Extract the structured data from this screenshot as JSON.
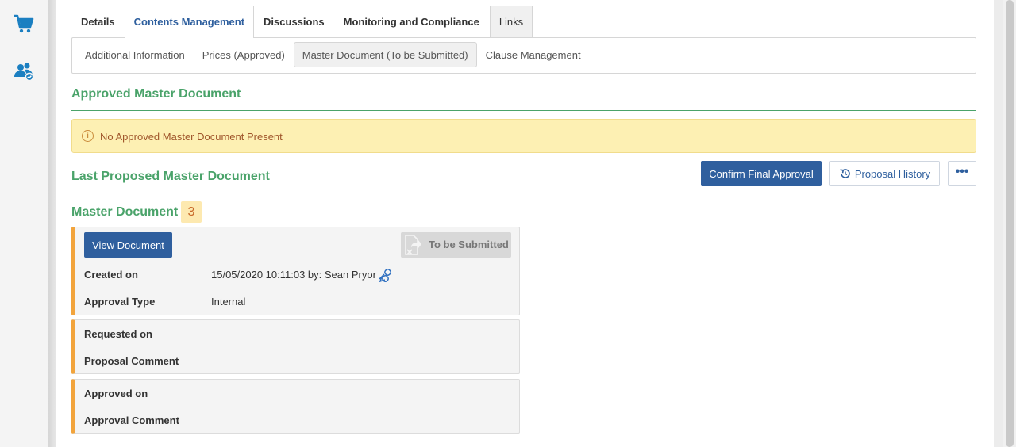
{
  "sidebar": {
    "icons": [
      {
        "name": "cart-icon"
      },
      {
        "name": "users-check-icon"
      }
    ]
  },
  "tabs": [
    {
      "label": "Details"
    },
    {
      "label": "Contents Management",
      "active": true
    },
    {
      "label": "Discussions"
    },
    {
      "label": "Monitoring and Compliance"
    },
    {
      "label": "Links"
    }
  ],
  "subtabs": [
    {
      "label": "Additional Information"
    },
    {
      "label": "Prices (Approved)"
    },
    {
      "label": "Master Document (To be Submitted)",
      "active": true
    },
    {
      "label": "Clause Management"
    }
  ],
  "approved_section": {
    "title": "Approved Master Document",
    "alert_text": "No Approved Master Document Present",
    "alert_icon": "info-icon"
  },
  "proposed_section": {
    "title": "Last Proposed Master Document",
    "confirm_label": "Confirm Final Approval",
    "history_label": "Proposal History",
    "more_label": "•••"
  },
  "master_document": {
    "title": "Master Document",
    "badge": "3",
    "view_label": "View Document",
    "status": "To be Submitted",
    "created_on_label": "Created on",
    "created_on_value": "15/05/2020 10:11:03 by: Sean Pryor",
    "approval_type_label": "Approval Type",
    "approval_type_value": "Internal",
    "requested_on_label": "Requested on",
    "proposal_comment_label": "Proposal Comment",
    "approved_on_label": "Approved on",
    "approval_comment_label": "Approval Comment"
  },
  "colors": {
    "brand_blue": "#2f5f9e",
    "section_green": "#4aa36a",
    "accent_orange": "#f2a43c",
    "alert_bg": "#fdf0b3"
  }
}
